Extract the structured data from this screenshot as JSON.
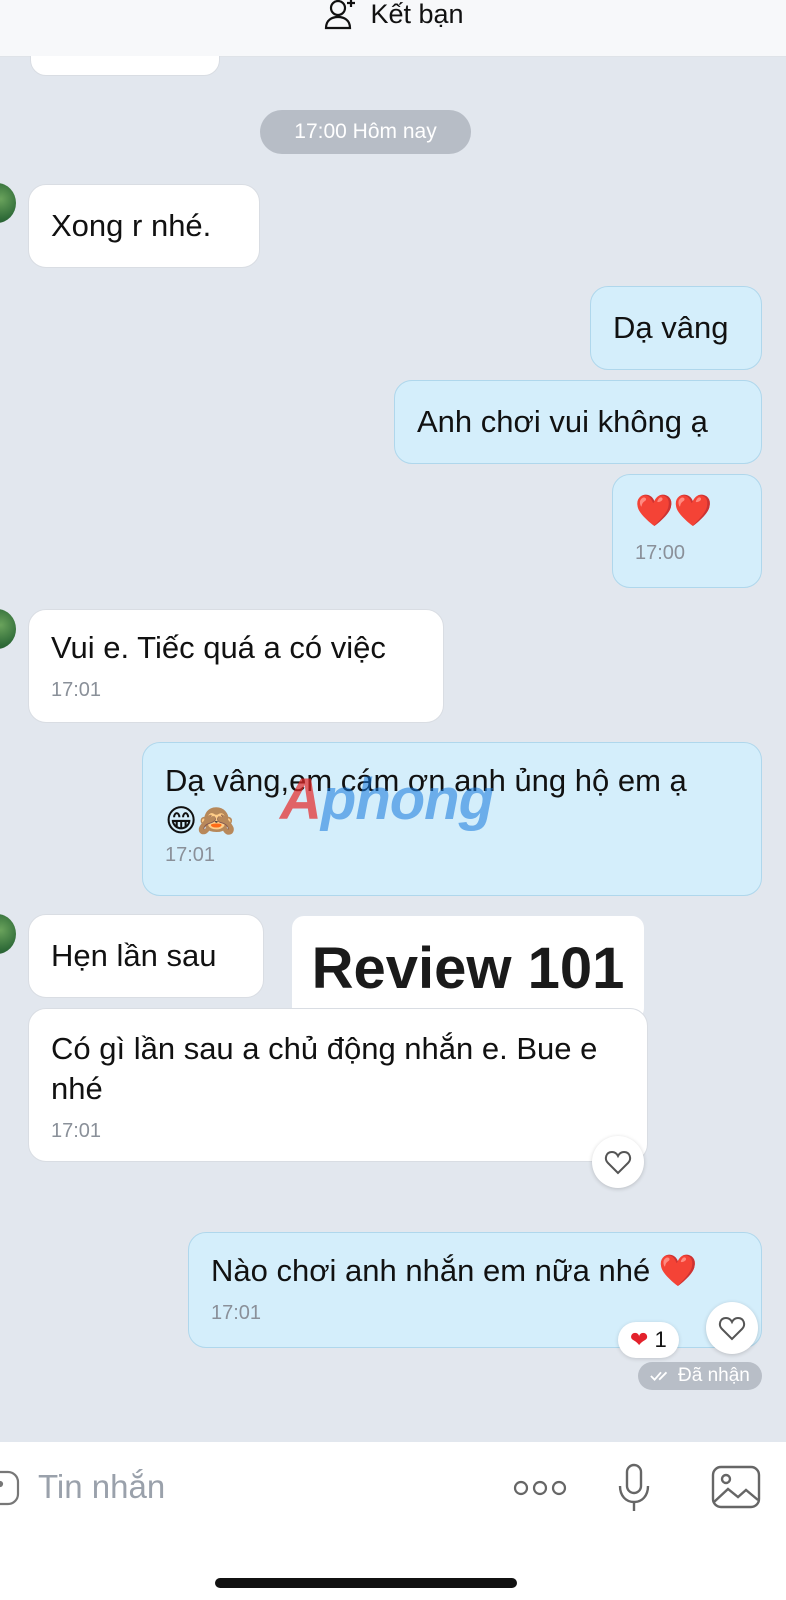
{
  "header": {
    "add_friend_label": "Kết bạn"
  },
  "chat": {
    "date_chip": "17:00 Hôm nay",
    "messages": [
      {
        "side": "in",
        "text": "Xong r nhé.",
        "time": ""
      },
      {
        "side": "out",
        "text": "Dạ vâng",
        "time": ""
      },
      {
        "side": "out",
        "text": "Anh chơi vui không ạ",
        "time": ""
      },
      {
        "side": "out",
        "text": "❤️❤️",
        "time": "17:00"
      },
      {
        "side": "in",
        "text": "Vui e. Tiếc quá a có việc",
        "time": "17:01"
      },
      {
        "side": "out",
        "text": "Dạ vâng,em cám ơn anh ủng hộ em ạ",
        "text2": "😁🙈",
        "time": "17:01"
      },
      {
        "side": "in",
        "text": "Hẹn lần sau",
        "time": ""
      },
      {
        "side": "in",
        "text": "Có gì lần sau a chủ động nhắn e. Bue e nhé",
        "time": "17:01"
      },
      {
        "side": "out",
        "text": "Nào chơi anh nhắn em nữa nhé ❤️",
        "time": "17:01"
      }
    ],
    "reaction_count": "1",
    "delivery_status": "Đã nhận",
    "overlay_label": "Review 101",
    "watermark": "Aphong"
  },
  "composer": {
    "placeholder": "Tin nhắn"
  }
}
